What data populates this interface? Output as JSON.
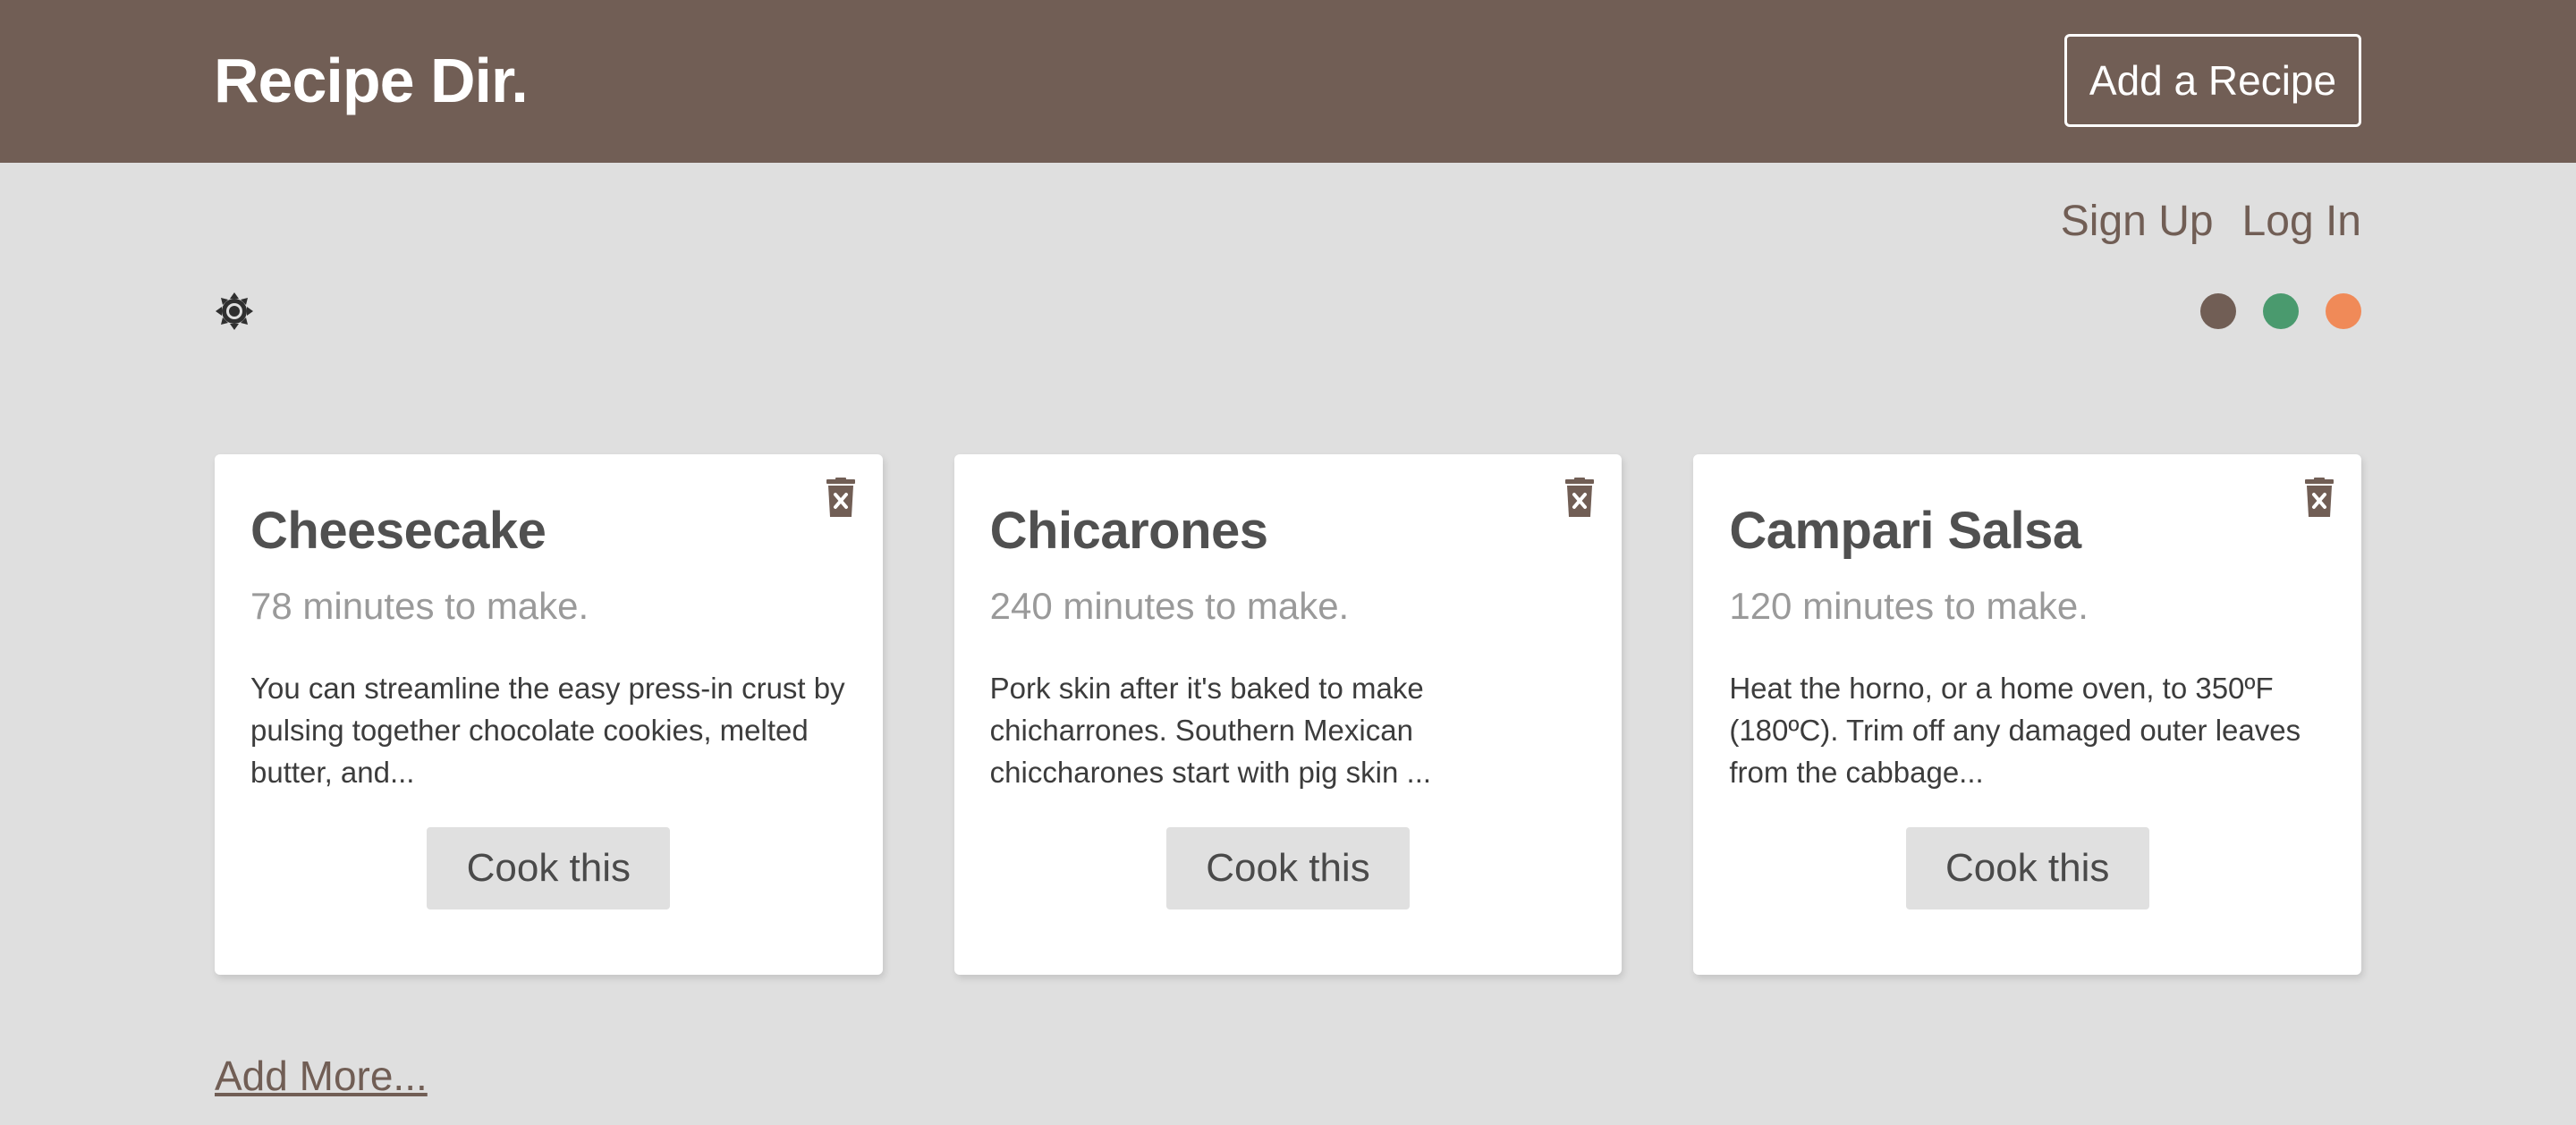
{
  "header": {
    "brand": "Recipe Dir.",
    "add_recipe_label": "Add a Recipe"
  },
  "auth": {
    "sign_up": "Sign Up",
    "log_in": "Log In"
  },
  "theme": {
    "icon": "sun-gear-icon",
    "swatches": [
      "#715e55",
      "#4a9a6e",
      "#f08a58"
    ]
  },
  "recipes": [
    {
      "title": "Cheesecake",
      "time": "78 minutes to make.",
      "description": "You can streamline the easy press-in crust by pulsing together chocolate cookies, melted butter, and...",
      "cook_label": "Cook this"
    },
    {
      "title": "Chicarones",
      "time": "240 minutes to make.",
      "description": "Pork skin after it's baked to make chicharrones. Southern Mexican chiccharones start with pig skin ...",
      "cook_label": "Cook this"
    },
    {
      "title": "Campari Salsa",
      "time": "120 minutes to make.",
      "description": "Heat the horno, or a home oven, to 350ºF (180ºC). Trim off any damaged outer leaves from the cabbage...",
      "cook_label": "Cook this"
    }
  ],
  "footer": {
    "add_more": "Add More..."
  },
  "colors": {
    "brand": "#715e55",
    "background": "#dfdfdf"
  }
}
